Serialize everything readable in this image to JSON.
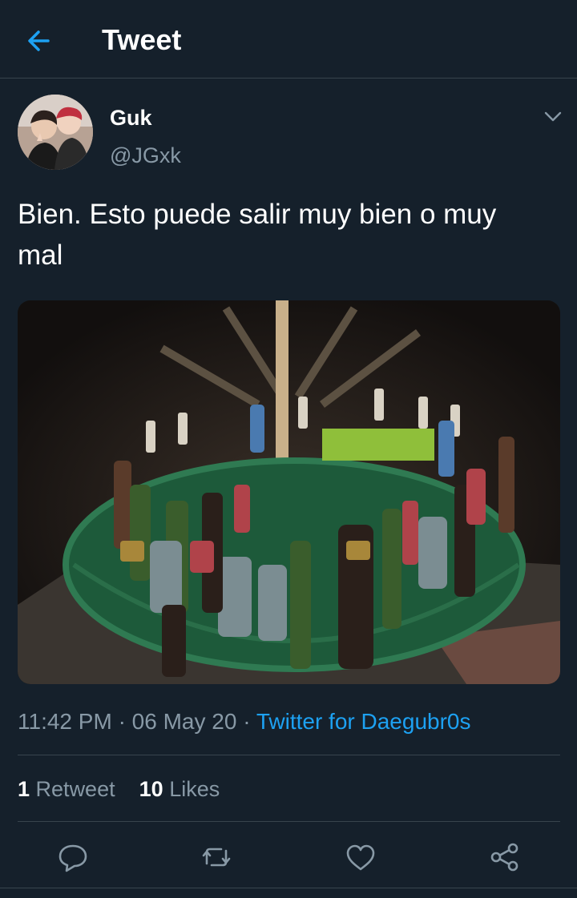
{
  "header": {
    "title": "Tweet",
    "back_icon": "arrow-left-icon"
  },
  "tweet": {
    "display_name": "Guk",
    "handle": "@JGxk",
    "text": "Bien. Esto puede salir muy bien o muy mal",
    "time": "11:42 PM",
    "date": "06 May 20",
    "source": "Twitter for Daegubr0s",
    "separator": "·"
  },
  "stats": {
    "retweets_count": "1",
    "retweets_label": "Retweet",
    "likes_count": "10",
    "likes_label": "Likes"
  },
  "actions": {
    "icons": [
      "reply-icon",
      "retweet-icon",
      "like-icon",
      "share-icon"
    ]
  },
  "colors": {
    "background": "#15202b",
    "accent": "#1da1f2",
    "muted": "#8899a6",
    "divider": "#38444d"
  }
}
